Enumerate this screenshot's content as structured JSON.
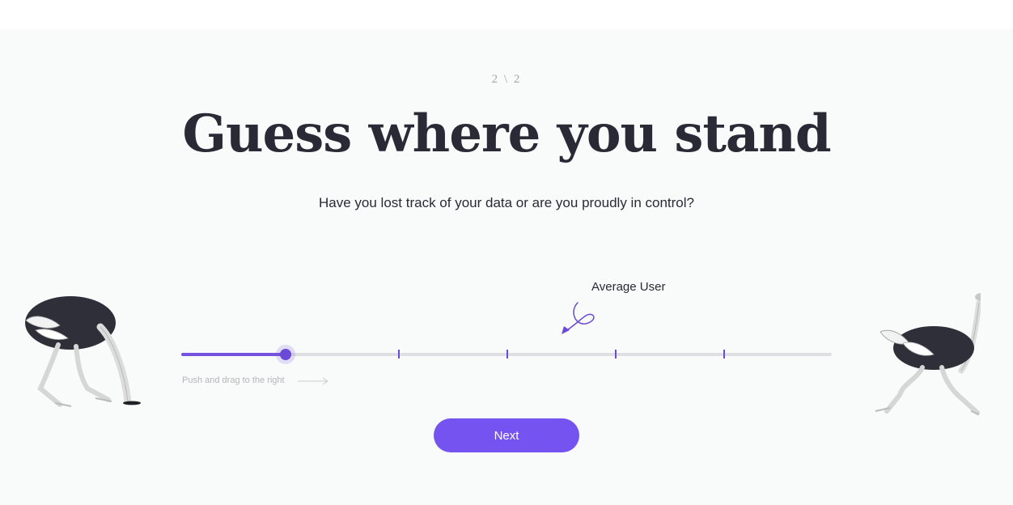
{
  "step": {
    "indicator": "2 \\ 2"
  },
  "heading": {
    "title": "Guess where you stand"
  },
  "subheading": {
    "text": "Have you lost track of your data or are you proudly in control?"
  },
  "slider": {
    "average_label": "Average User",
    "value": 0.16,
    "hint": "Push and drag to the right",
    "accent_color": "#7553e0",
    "track_color": "#dfdfe1"
  },
  "actions": {
    "next_label": "Next",
    "button_color": "#7553f0"
  },
  "illustrations": {
    "left": "ostrich-head-in-sand",
    "right": "ostrich-running"
  }
}
